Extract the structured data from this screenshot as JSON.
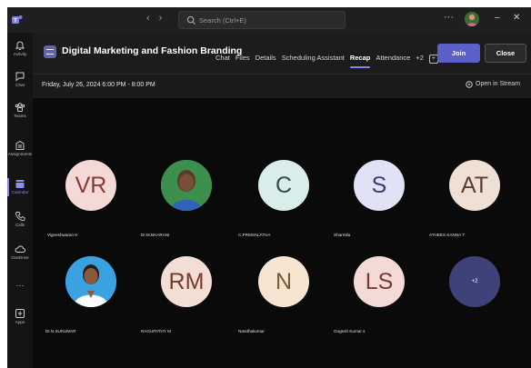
{
  "topbar": {
    "search_placeholder": "Search (Ctrl+E)",
    "nav_back": "‹",
    "nav_forward": "›",
    "more": "···",
    "minimize": "–",
    "close": "✕"
  },
  "rail": {
    "items": [
      {
        "label": "Activity",
        "icon": "bell-icon"
      },
      {
        "label": "Chat",
        "icon": "chat-icon"
      },
      {
        "label": "Teams",
        "icon": "teams-icon"
      },
      {
        "label": "Assignments",
        "icon": "assignments-icon"
      },
      {
        "label": "Calendar",
        "icon": "calendar-icon",
        "active": true
      },
      {
        "label": "Calls",
        "icon": "phone-icon"
      },
      {
        "label": "OneDrive",
        "icon": "cloud-icon"
      },
      {
        "label": "···",
        "icon": "more-icon"
      },
      {
        "label": "Apps",
        "icon": "apps-icon"
      }
    ]
  },
  "header": {
    "title": "Digital Marketing and Fashion Branding",
    "tabs": [
      "Chat",
      "Files",
      "Details",
      "Scheduling Assistant",
      "Recap",
      "Attendance",
      "+2"
    ],
    "active_tab": "Recap",
    "join_label": "Join",
    "close_label": "Close"
  },
  "subheader": {
    "date": "Friday, July 26, 2024 6:00 PM - 8:00 PM",
    "open_stream": "Open in Stream"
  },
  "participants": [
    {
      "initials": "VR",
      "name": "Vigneshwaran K",
      "color": "#f4d9d7"
    },
    {
      "initials": "",
      "name": "Dr.M.BHARANI",
      "color": "#3c8a4a",
      "photo": true
    },
    {
      "initials": "C",
      "name": "C.PREMALATHA",
      "color": "#d9eeea"
    },
    {
      "initials": "S",
      "name": "Sharmila",
      "color": "#e1e2f5"
    },
    {
      "initials": "AT",
      "name": "ATHEES KANNA T",
      "color": "#efe0d6"
    },
    {
      "initials": "",
      "name": "Dr.N.SUKUMAR",
      "color": "#3aa0e0",
      "photo": true
    },
    {
      "initials": "RM",
      "name": "RAGUPATHY M",
      "color": "#f3ded6"
    },
    {
      "initials": "N",
      "name": "Nandhakumar",
      "color": "#f7e5d2"
    },
    {
      "initials": "LS",
      "name": "Gogesh Kumar s",
      "color": "#f4dad7"
    },
    {
      "initials": "+2",
      "name": "",
      "color": "#3f4279",
      "more": true
    }
  ],
  "colors": {
    "accent": "#5b5fc7",
    "background": "#0b0b0b",
    "header": "#1c1c1c"
  }
}
